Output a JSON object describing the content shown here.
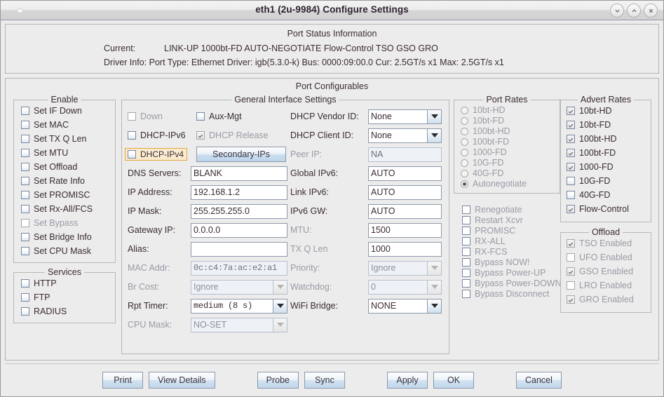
{
  "window": {
    "title": "eth1  (2u-9984) Configure Settings",
    "buttons": {
      "minimize": "minimize-icon",
      "maximize": "maximize-icon",
      "close": "close-icon"
    }
  },
  "status": {
    "title": "Port Status Information",
    "current_label": "Current:",
    "current_value": "LINK-UP 1000bt-FD AUTO-NEGOTIATE Flow-Control TSO GSO GRO",
    "driver_label": "Driver Info:",
    "driver_value": "Port Type: Ethernet   Driver: igb(5.3.0-k)  Bus: 0000:09:00.0 Cur: 2.5GT/s x1  Max: 2.5GT/s x1"
  },
  "config": {
    "title": "Port Configurables"
  },
  "enable": {
    "legend": "Enable",
    "items": [
      {
        "label": "Set IF Down",
        "checked": false,
        "disabled": false
      },
      {
        "label": "Set MAC",
        "checked": false,
        "disabled": false
      },
      {
        "label": "Set TX Q Len",
        "checked": false,
        "disabled": false
      },
      {
        "label": "Set MTU",
        "checked": false,
        "disabled": false
      },
      {
        "label": "Set Offload",
        "checked": false,
        "disabled": false
      },
      {
        "label": "Set Rate Info",
        "checked": false,
        "disabled": false
      },
      {
        "label": "Set PROMISC",
        "checked": false,
        "disabled": false
      },
      {
        "label": "Set Rx-All/FCS",
        "checked": false,
        "disabled": false
      },
      {
        "label": "Set Bypass",
        "checked": false,
        "disabled": true
      },
      {
        "label": "Set Bridge Info",
        "checked": false,
        "disabled": false
      },
      {
        "label": "Set CPU Mask",
        "checked": false,
        "disabled": false
      }
    ]
  },
  "services": {
    "legend": "Services",
    "items": [
      {
        "label": "HTTP",
        "checked": false,
        "disabled": false
      },
      {
        "label": "FTP",
        "checked": false,
        "disabled": false
      },
      {
        "label": "RADIUS",
        "checked": false,
        "disabled": false
      }
    ]
  },
  "general": {
    "legend": "General Interface Settings",
    "checks": {
      "down": {
        "label": "Down",
        "checked": false,
        "disabled": true
      },
      "aux_mgt": {
        "label": "Aux-Mgt",
        "checked": false,
        "disabled": false
      },
      "dhcp_ipv6": {
        "label": "DHCP-IPv6",
        "checked": false,
        "disabled": false
      },
      "dhcp_release": {
        "label": "DHCP Release",
        "checked": true,
        "disabled": true
      },
      "dhcp_ipv4": {
        "label": "DHCP-IPv4",
        "checked": false,
        "disabled": false,
        "highlighted": true
      }
    },
    "secondary_ips_button": "Secondary-IPs",
    "left_fields": [
      {
        "label": "DNS Servers:",
        "value": "BLANK",
        "disabled": false,
        "mono": false
      },
      {
        "label": "IP Address:",
        "value": "192.168.1.2",
        "disabled": false,
        "mono": false
      },
      {
        "label": "IP Mask:",
        "value": "255.255.255.0",
        "disabled": false,
        "mono": false
      },
      {
        "label": "Gateway IP:",
        "value": "0.0.0.0",
        "disabled": false,
        "mono": false
      },
      {
        "label": "Alias:",
        "value": "",
        "disabled": false,
        "mono": false
      },
      {
        "label": "MAC Addr:",
        "value": "0c:c4:7a:ac:e2:a1",
        "disabled": true,
        "mono": true
      }
    ],
    "left_combos": [
      {
        "label": "Br Cost:",
        "value": "Ignore",
        "disabled": true,
        "mono": false
      },
      {
        "label": "Rpt Timer:",
        "value": "medium  (8 s)",
        "disabled": false,
        "mono": true
      },
      {
        "label": "CPU Mask:",
        "value": "NO-SET",
        "disabled": true,
        "mono": false
      }
    ],
    "right_rows": [
      {
        "label": "DHCP Vendor ID:",
        "value": "None",
        "type": "combo",
        "disabled": false
      },
      {
        "label": "DHCP Client ID:",
        "value": "None",
        "type": "combo",
        "disabled": false
      },
      {
        "label": "Peer IP:",
        "value": "NA",
        "type": "text",
        "disabled": true
      },
      {
        "label": "Global IPv6:",
        "value": "AUTO",
        "type": "text",
        "disabled": false
      },
      {
        "label": "Link IPv6:",
        "value": "AUTO",
        "type": "text",
        "disabled": false
      },
      {
        "label": "IPv6 GW:",
        "value": "AUTO",
        "type": "text",
        "disabled": false
      },
      {
        "label": "MTU:",
        "value": "1500",
        "type": "text",
        "disabled": false,
        "label_disabled": true
      },
      {
        "label": "TX Q Len",
        "value": "1000",
        "type": "text",
        "disabled": false,
        "label_disabled": true
      },
      {
        "label": "Priority:",
        "value": "Ignore",
        "type": "combo",
        "disabled": true
      },
      {
        "label": "Watchdog:",
        "value": "0",
        "type": "combo",
        "disabled": true
      },
      {
        "label": "WiFi Bridge:",
        "value": "NONE",
        "type": "combo",
        "disabled": false
      }
    ]
  },
  "actions": {
    "items": [
      {
        "label": "Renegotiate",
        "checked": false,
        "disabled": true
      },
      {
        "label": "Restart Xcvr",
        "checked": false,
        "disabled": true
      },
      {
        "label": "PROMISC",
        "checked": false,
        "disabled": true
      },
      {
        "label": "RX-ALL",
        "checked": false,
        "disabled": true
      },
      {
        "label": "RX-FCS",
        "checked": false,
        "disabled": true
      },
      {
        "label": "Bypass NOW!",
        "checked": false,
        "disabled": true
      },
      {
        "label": "Bypass Power-UP",
        "checked": false,
        "disabled": true
      },
      {
        "label": "Bypass Power-DOWN",
        "checked": false,
        "disabled": true
      },
      {
        "label": "Bypass Disconnect",
        "checked": false,
        "disabled": true
      }
    ]
  },
  "port_rates": {
    "legend": "Port Rates",
    "items": [
      {
        "label": "10bt-HD",
        "selected": false
      },
      {
        "label": "10bt-FD",
        "selected": false
      },
      {
        "label": "100bt-HD",
        "selected": false
      },
      {
        "label": "100bt-FD",
        "selected": false
      },
      {
        "label": "1000-FD",
        "selected": false
      },
      {
        "label": "10G-FD",
        "selected": false
      },
      {
        "label": "40G-FD",
        "selected": false
      },
      {
        "label": "Autonegotiate",
        "selected": true
      }
    ]
  },
  "advert_rates": {
    "legend": "Advert Rates",
    "items": [
      {
        "label": "10bt-HD",
        "checked": true
      },
      {
        "label": "10bt-FD",
        "checked": true
      },
      {
        "label": "100bt-HD",
        "checked": true
      },
      {
        "label": "100bt-FD",
        "checked": true
      },
      {
        "label": "1000-FD",
        "checked": true
      },
      {
        "label": "10G-FD",
        "checked": false
      },
      {
        "label": "40G-FD",
        "checked": false
      },
      {
        "label": "Flow-Control",
        "checked": true
      }
    ]
  },
  "offload": {
    "legend": "Offload",
    "items": [
      {
        "label": "TSO Enabled",
        "checked": true,
        "disabled": true
      },
      {
        "label": "UFO Enabled",
        "checked": false,
        "disabled": true
      },
      {
        "label": "GSO Enabled",
        "checked": true,
        "disabled": true
      },
      {
        "label": "LRO Enabled",
        "checked": false,
        "disabled": true
      },
      {
        "label": "GRO Enabled",
        "checked": true,
        "disabled": true
      }
    ]
  },
  "footer": {
    "buttons": [
      "Print",
      "View Details",
      "Probe",
      "Sync",
      "Apply",
      "OK",
      "Cancel"
    ]
  }
}
